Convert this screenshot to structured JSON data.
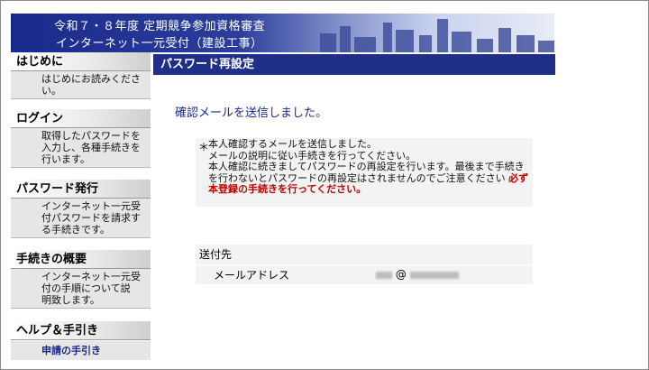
{
  "header": {
    "line1": "令和７・８年度 定期競争参加資格審査",
    "line2": "インターネット一元受付（建設工事）"
  },
  "sidebar": {
    "sections": [
      {
        "title": "はじめに",
        "body": "はじめにお読みくださ\nい。"
      },
      {
        "title": "ログイン",
        "body": "取得したパスワードを\n入力し、各種手続きを\n行います。"
      },
      {
        "title": "パスワード発行",
        "body": "インターネット一元受\n付パスワードを請求す\nる手続きです。"
      },
      {
        "title": "手続きの概要",
        "body": "インターネット一元受\n付の手順について説\n明致します。"
      },
      {
        "title": "ヘルプ＆手引き"
      }
    ],
    "sub_link": "申請の手引き"
  },
  "main": {
    "title": "パスワード再設定",
    "confirm": "確認メールを送信しました。",
    "notice": {
      "mark": "＊",
      "text": "本人確認するメールを送信しました。\nメールの説明に従い手続きを行ってください。\n本人確認に続きましてパスワードの再設定を行います。最後まで手続きを行わないとパスワードの再設定はされませんのでご注意ください",
      "warning": "必ず本登録の手続きを行ってください。"
    },
    "destination": {
      "heading": "送付先",
      "label": "メールアドレス",
      "value_at": "@"
    }
  }
}
